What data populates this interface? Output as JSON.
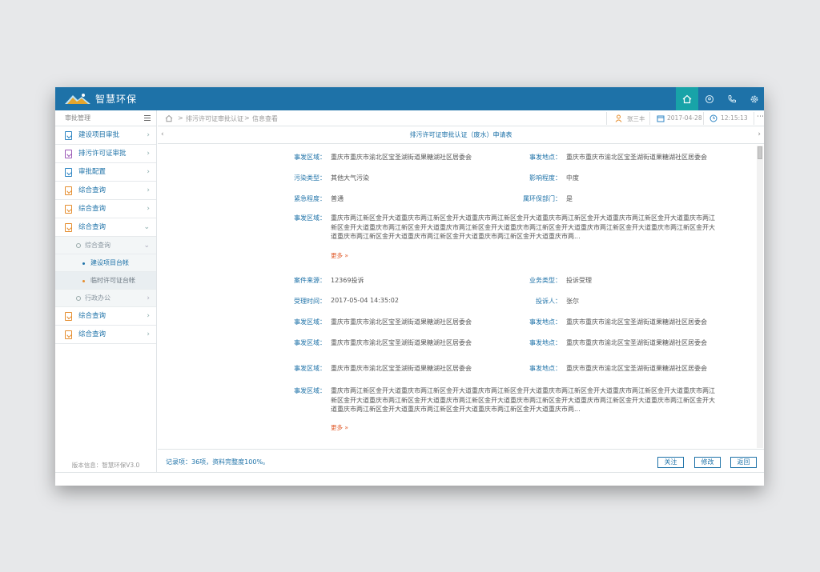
{
  "app": {
    "title": "智慧环保"
  },
  "topbar": {
    "icons": [
      "home-icon",
      "location-icon",
      "phone-icon",
      "gear-icon"
    ],
    "accent": "#18a3a8",
    "brand": "#1e72a8"
  },
  "sidebar": {
    "header": "审批管理",
    "items": [
      {
        "label": "建设项目审批",
        "icon": "document-icon"
      },
      {
        "label": "排污许可证审批",
        "icon": "document-icon"
      },
      {
        "label": "审批配置",
        "icon": "document-icon"
      },
      {
        "label": "综合查询",
        "icon": "document-icon"
      },
      {
        "label": "综合查询",
        "icon": "document-icon"
      },
      {
        "label": "综合查询",
        "icon": "document-icon"
      }
    ],
    "sub": {
      "group1": "综合查询",
      "leaf1": "建设项目台帐",
      "leaf2": "临时许可证台帐",
      "group2": "行政办公"
    },
    "items_after": [
      {
        "label": "综合查询"
      },
      {
        "label": "综合查询"
      }
    ],
    "footer": "版本信息：智慧环保V3.0"
  },
  "breadcrumb": {
    "path": "排污许可证审批认证",
    "current": "信息查看",
    "user": "张三丰",
    "date": "2017-04-28",
    "time": "12:15:13"
  },
  "form": {
    "title": "排污许可证审批认证（废水）申请表",
    "fields": {
      "area_label": "事发区域：",
      "area_value": "重庆市重庆市渝北区宝圣湖街道果糖湖社区居委会",
      "place_label": "事发地点：",
      "place_value": "重庆市重庆市渝北区宝圣湖街道果糖湖社区居委会",
      "pollution_label": "污染类型：",
      "pollution_value": "其他大气污染",
      "impact_label": "影响程度：",
      "impact_value": "中度",
      "urgency_label": "紧急程度：",
      "urgency_value": "普通",
      "dept_label": "属环保部门：",
      "dept_value": "是",
      "source_label": "案件来源：",
      "source_value": "12369投诉",
      "btype_label": "业务类型：",
      "btype_value": "投诉受理",
      "time_label": "受理时间：",
      "time_value": "2017-05-04 14:35:02",
      "complainant_label": "投诉人：",
      "complainant_value": "张尔"
    },
    "long_text": "重庆市两江新区金开大道重庆市两江新区金开大道重庆市两江新区金开大道重庆市两江新区金开大道重庆市两江新区金开大道重庆市两江新区金开大道重庆市两江新区金开大道重庆市两江新区金开大道重庆市两江新区金开大道重庆市两江新区金开大道重庆市两江新区金开大道重庆市两江新区金开大道重庆市两江新区金开大道重庆市两江新区金开大道重庆市两...",
    "more": "更多 »"
  },
  "footer": {
    "summary": "记录项：36项，资料完整度100%。",
    "follow": "关注",
    "edit": "修改",
    "back": "返回"
  }
}
